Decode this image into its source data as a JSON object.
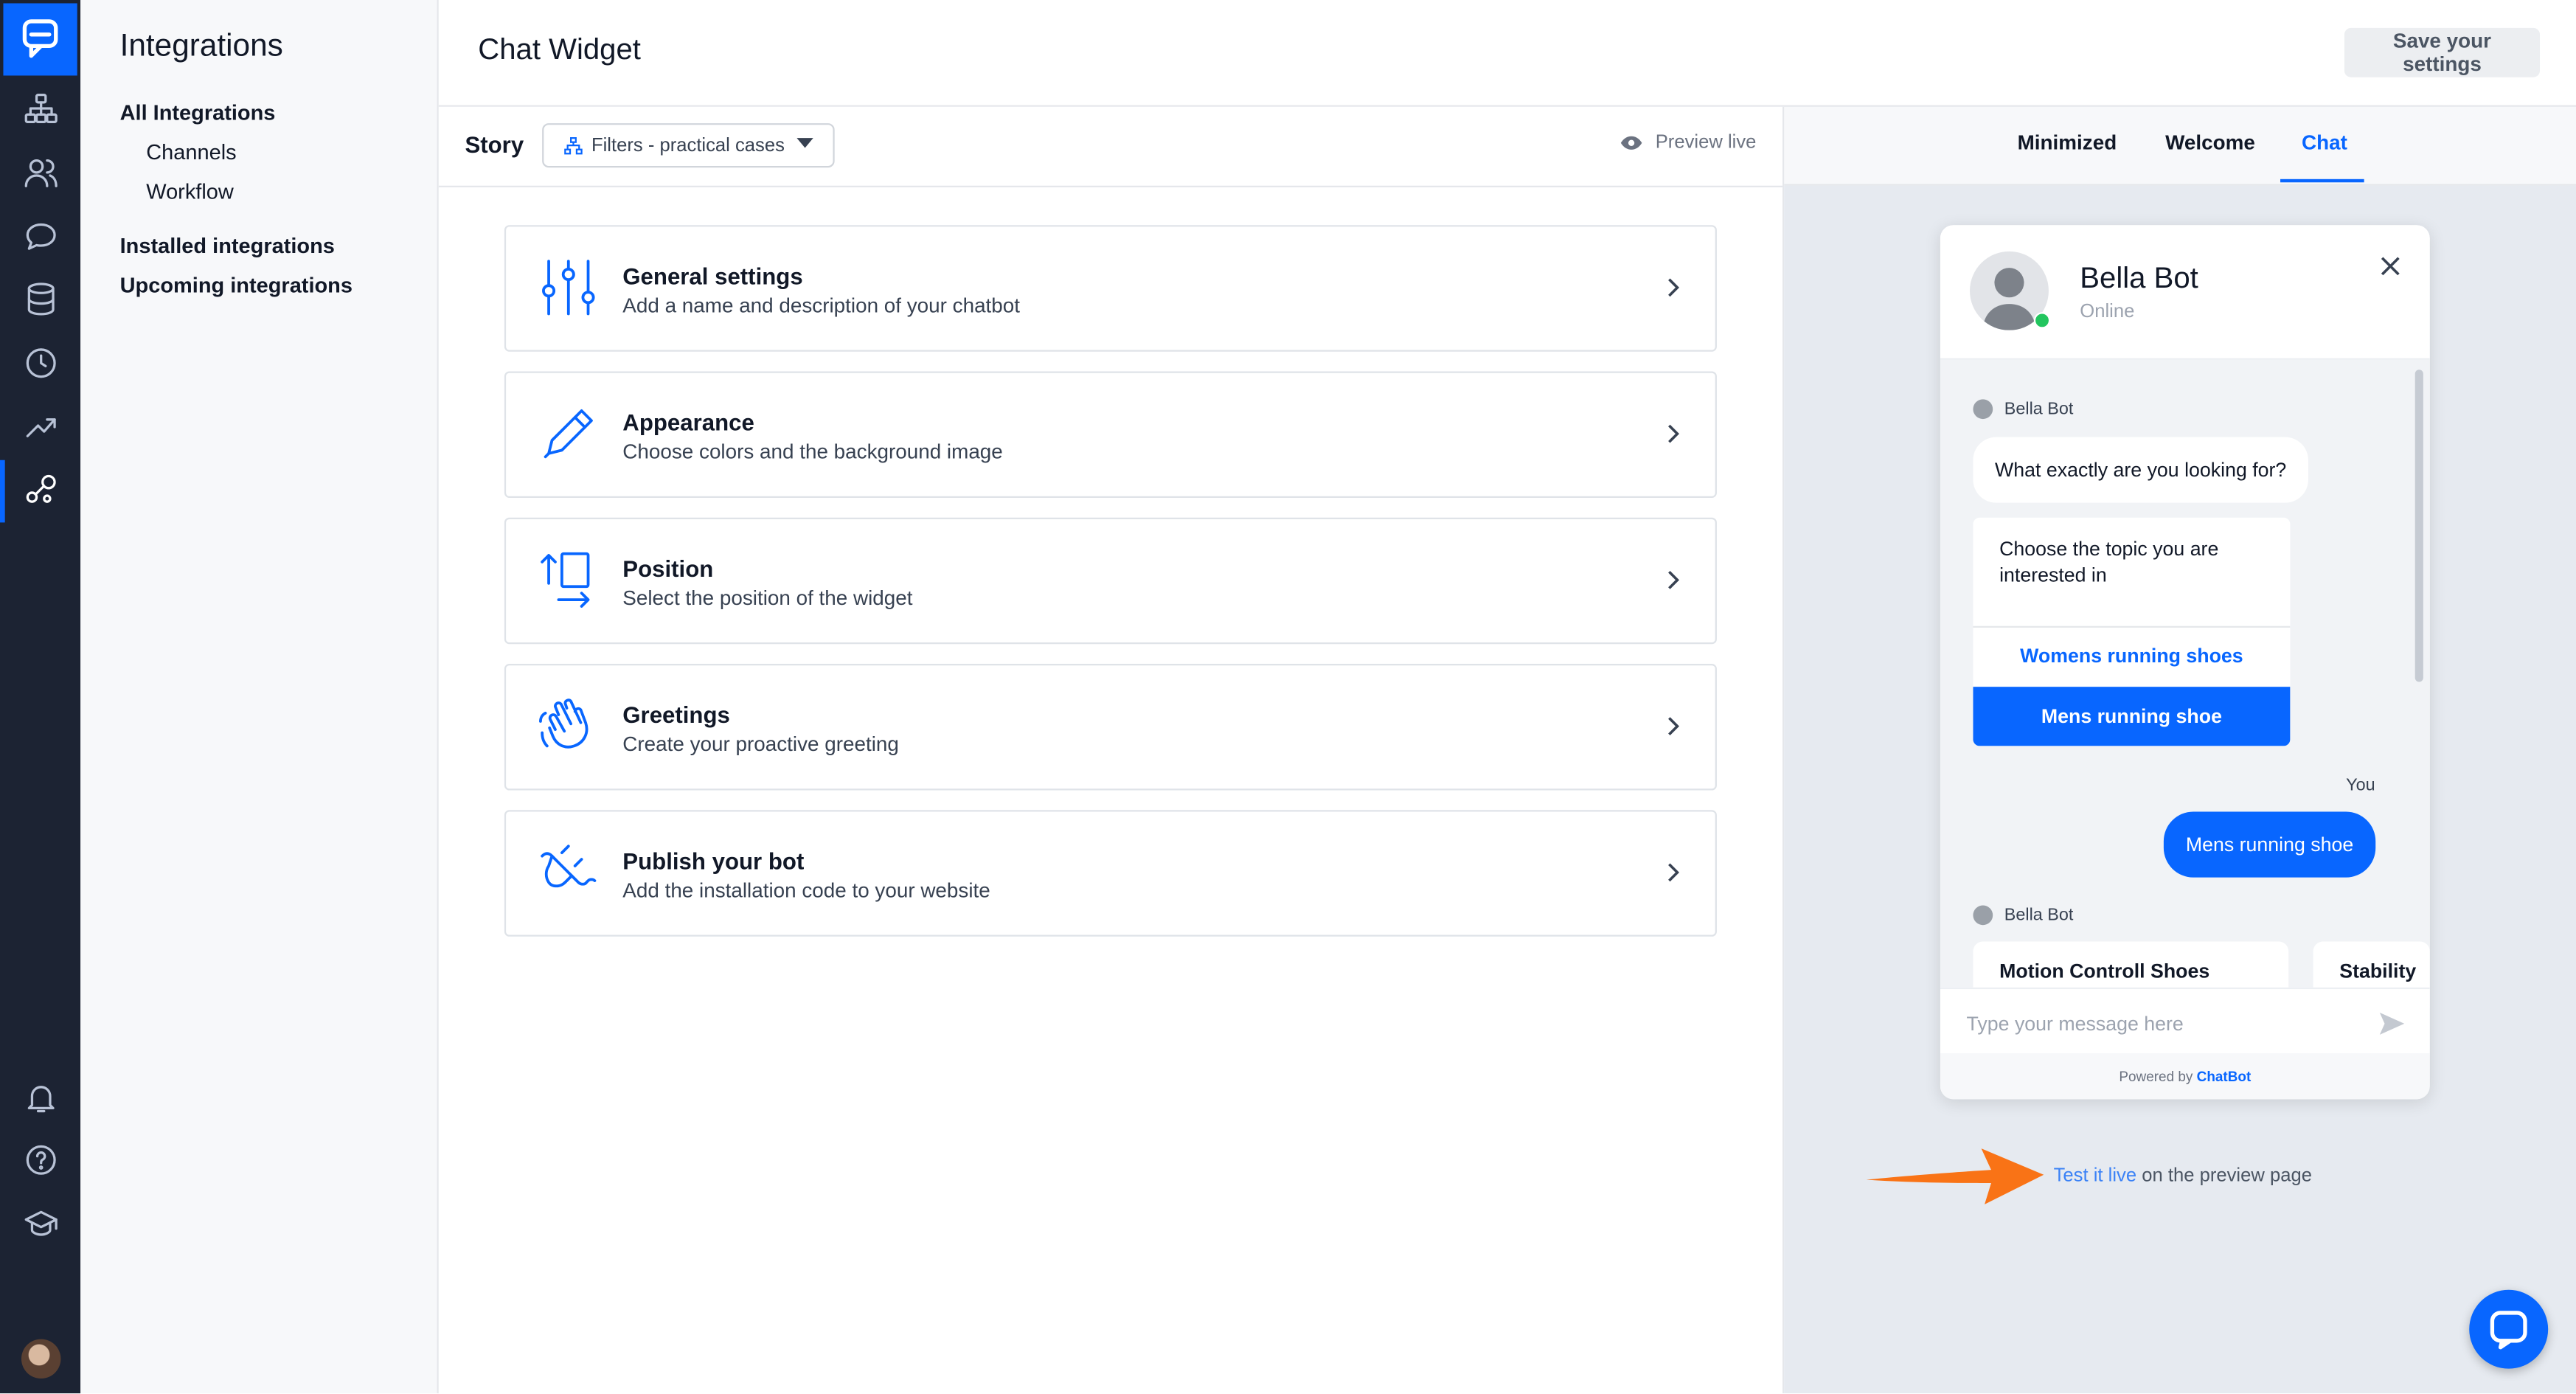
{
  "sidebar": {
    "title": "Integrations",
    "items": [
      {
        "label": "All Integrations",
        "bold": true
      },
      {
        "label": "Channels",
        "bold": false
      },
      {
        "label": "Workflow",
        "bold": false
      },
      {
        "label": "Installed integrations",
        "bold": true
      },
      {
        "label": "Upcoming integrations",
        "bold": true
      }
    ]
  },
  "header": {
    "title": "Chat Widget",
    "save_label": "Save your settings"
  },
  "story": {
    "label": "Story",
    "selected": "Filters - practical cases",
    "preview_label": "Preview live"
  },
  "cards": [
    {
      "icon": "sliders-icon",
      "title": "General settings",
      "desc": "Add a name and description of your chatbot"
    },
    {
      "icon": "pencil-icon",
      "title": "Appearance",
      "desc": "Choose colors and the background image"
    },
    {
      "icon": "position-icon",
      "title": "Position",
      "desc": "Select the position of the widget"
    },
    {
      "icon": "wave-hand-icon",
      "title": "Greetings",
      "desc": "Create your proactive greeting"
    },
    {
      "icon": "plug-icon",
      "title": "Publish your bot",
      "desc": "Add the installation code to your website"
    }
  ],
  "preview_tabs": [
    {
      "label": "Minimized",
      "active": false
    },
    {
      "label": "Welcome",
      "active": false
    },
    {
      "label": "Chat",
      "active": true
    }
  ],
  "widget": {
    "bot_name": "Bella Bot",
    "status": "Online",
    "sender_bot": "Bella Bot",
    "msg1": "What exactly are you looking for?",
    "question": "Choose the topic you are interested in",
    "option1": "Womens running shoes",
    "option2": "Mens running shoe",
    "sender_you": "You",
    "user_msg": "Mens running shoe",
    "sender_bot2": "Bella Bot",
    "product1": "Motion Controll Shoes",
    "product2": "Stability",
    "input_placeholder": "Type your message here",
    "powered_prefix": "Powered by ",
    "powered_brand": "ChatBot"
  },
  "test_live": {
    "link": "Test it live",
    "rest": " on the preview page"
  },
  "colors": {
    "accent": "#0866ff",
    "rail": "#1c2333",
    "arrow": "#f97316"
  }
}
